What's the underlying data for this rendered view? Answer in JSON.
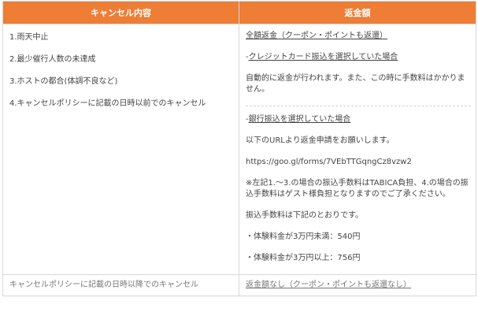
{
  "table": {
    "headers": [
      "キャンセル内容",
      "返金額"
    ],
    "left_items": [
      "1.雨天中止",
      "2.最少催行人数の未達成",
      "3.ホストの都合(体調不良など)",
      "4.キャンセルポリシーに記載の日時以前でのキャンセル"
    ],
    "right": {
      "full_refund": "全額返金（クーポン・ポイントも返還）",
      "credit_title": "クレジットカード振込を選択していた場合",
      "credit_desc": "自動的に返金が行われます。また、この時に手数料はかかりません。",
      "bank_title": "銀行振込を選択していた場合",
      "bank_desc": "以下のURLより返金申請をお願いします。",
      "url": "https://goo.gl/forms/7VEbTTGqngCz8vzw2",
      "note": "※左記1.〜3.の場合の振込手数料はTABICA負担、4.の場合の振込手数料はゲスト様負担となりますのでご了承ください。",
      "fee_intro": "振込手数料は下記のとおりです。",
      "fee1": "・体験料金が3万円未満：540円",
      "fee2": "・体験料金が3万円以上：756円"
    },
    "last_row": {
      "left": "キャンセルポリシーに記載の日時以降でのキャンセル",
      "right": "返金額なし（クーポン・ポイントも返還なし）"
    }
  }
}
